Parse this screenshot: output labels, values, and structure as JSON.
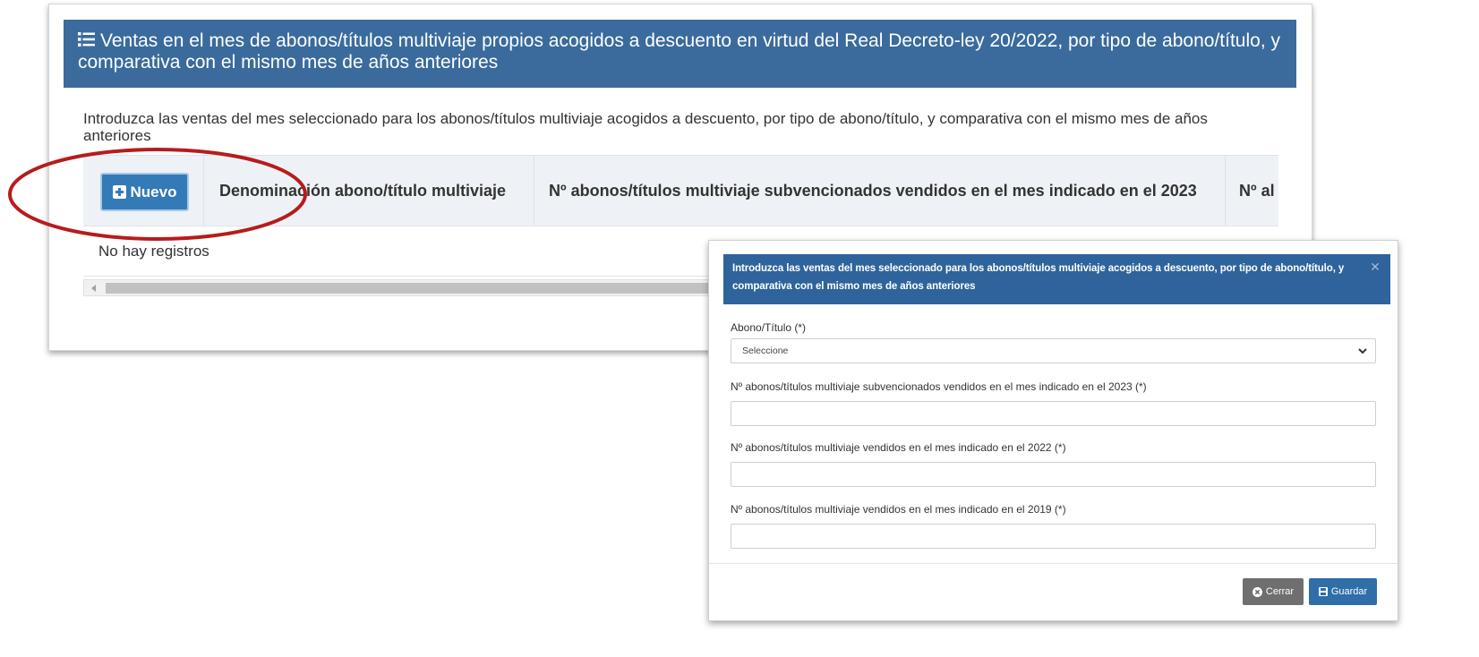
{
  "panel": {
    "header_title": "Ventas en el mes de abonos/títulos multiviaje propios acogidos a descuento en virtud del Real Decreto-ley 20/2022, por tipo de abono/título, y comparativa con el mismo mes de años anteriores",
    "header_icon": "list-icon",
    "description": "Introduzca las ventas del mes seleccionado para los abonos/títulos multiviaje acogidos a descuento, por tipo de abono/título, y comparativa con el mismo mes de años anteriores",
    "new_button_label": "Nuevo",
    "new_button_icon": "plus-square-icon",
    "columns": [
      "Denominación abono/título multiviaje",
      "Nº abonos/títulos multiviaje subvencionados vendidos en el mes indicado en el 2023",
      "Nº al"
    ],
    "empty_message": "No hay registros"
  },
  "modal": {
    "title": "Introduzca las ventas del mes seleccionado para los abonos/títulos multiviaje acogidos a descuento, por tipo de abono/título, y comparativa con el mismo mes de años anteriores",
    "close_icon": "close-icon",
    "fields": {
      "abono_label": "Abono/Título (*)",
      "abono_selected": "Seleccione",
      "n2023_label": "Nº abonos/títulos multiviaje subvencionados vendidos en el mes indicado en el 2023 (*)",
      "n2023_value": "",
      "n2022_label": "Nº abonos/títulos multiviaje vendidos en el mes indicado en el 2022 (*)",
      "n2022_value": "",
      "n2019_label": "Nº abonos/títulos multiviaje vendidos en el mes indicado en el 2019 (*)",
      "n2019_value": ""
    },
    "buttons": {
      "close_label": "Cerrar",
      "save_label": "Guardar"
    }
  },
  "colors": {
    "panel_header_bg": "#3a6b9c",
    "modal_header_bg": "#2f639b",
    "primary_button": "#337ab7",
    "close_button": "#6f6f6f",
    "highlight_ellipse": "#b71c1c"
  }
}
